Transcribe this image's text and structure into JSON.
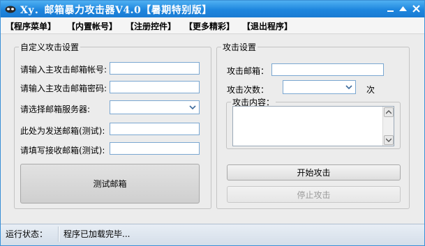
{
  "window": {
    "title": "Xy．邮箱暴力攻击器V4.0【暑期特别版】",
    "controls": [
      "minimize",
      "maximize",
      "close"
    ]
  },
  "menu": {
    "items": [
      "【程序菜单】",
      "【内置帐号】",
      "【注册控件】",
      "【更多精彩】",
      "【退出程序】"
    ]
  },
  "custom_attack": {
    "legend": "自定义攻击设置",
    "account_label": "请输入主攻击邮箱帐号:",
    "account_value": "",
    "password_label": "请输入主攻击邮箱密码:",
    "password_value": "",
    "server_label": "请选择邮箱服务器:",
    "server_value": "",
    "send_test_label": "此处为发送邮箱(测试):",
    "send_test_value": "",
    "receive_label": "请填写接收邮箱(测试):",
    "receive_value": "",
    "test_button": "测试邮箱"
  },
  "attack_settings": {
    "legend": "攻击设置",
    "target_label": "攻击邮箱：",
    "target_value": "",
    "count_label": "攻击次数：",
    "count_value": "",
    "count_unit": "次",
    "content_legend": "攻击内容：",
    "content_value": "",
    "start_button": "开始攻击",
    "stop_button": "停止攻击"
  },
  "status": {
    "label": "运行状态：",
    "value": "程序已加载完毕..."
  },
  "icons": {
    "app": "app-logo-icon",
    "minimize": "minimize-icon",
    "maximize": "maximize-icon",
    "close": "close-icon",
    "dropdown": "chevron-down-icon",
    "scroll_up": "scroll-up-icon",
    "scroll_down": "scroll-down-icon"
  },
  "colors": {
    "titlebar": "#1e86de",
    "frame": "#3a8fd6",
    "background": "#ececec",
    "input_border": "#7aa7d1",
    "disabled_text": "#9b9b9b"
  }
}
